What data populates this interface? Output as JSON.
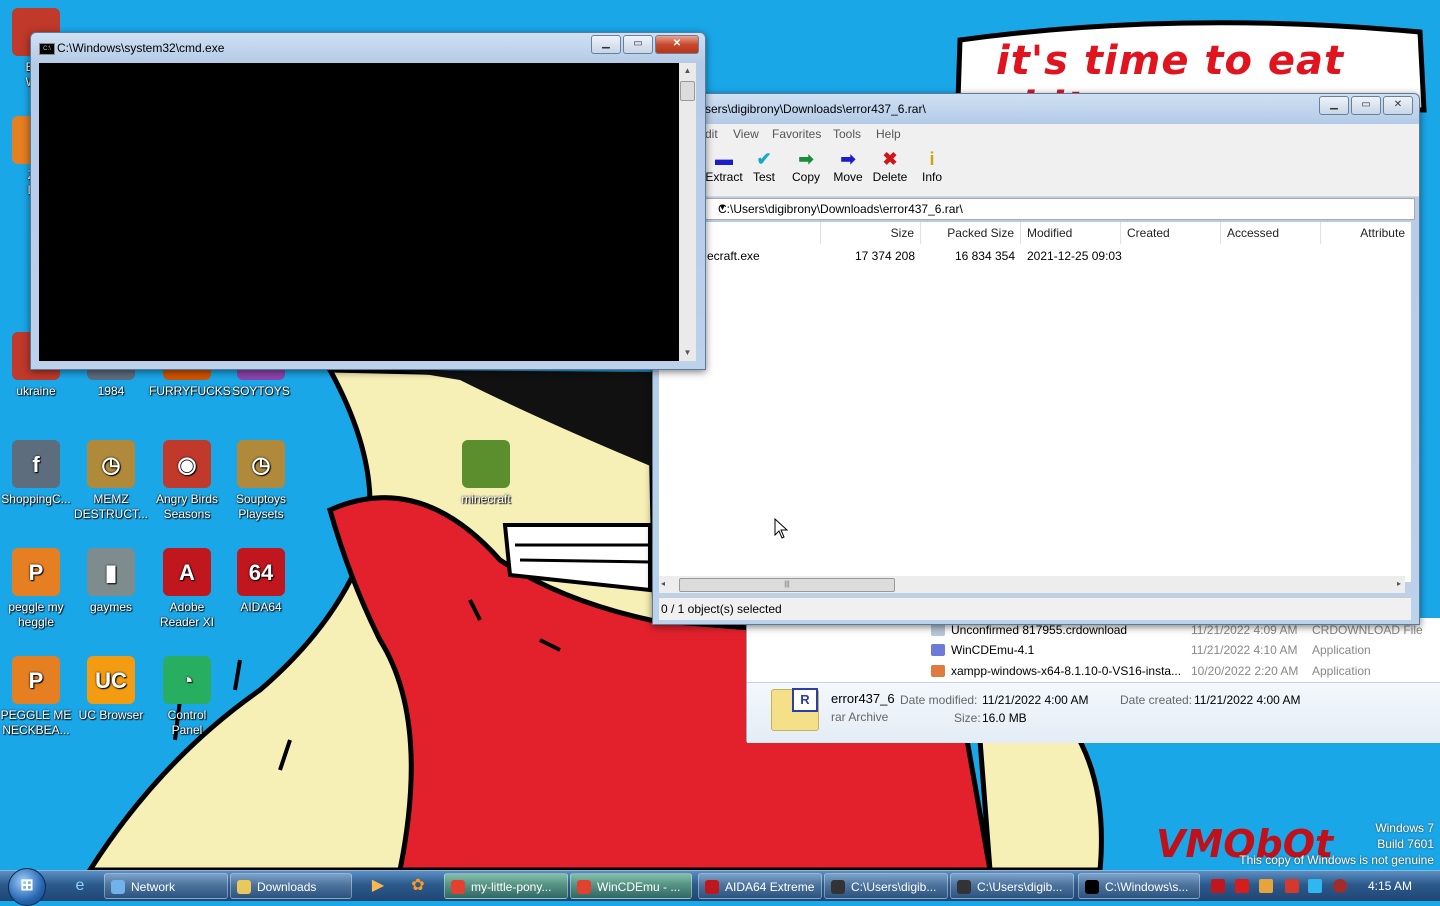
{
  "wallpaper": {
    "banner": "it's time to eat shit",
    "brand": "VMObOt",
    "watermark": [
      "Windows 7",
      "Build 7601",
      "This copy of Windows is not genuine"
    ]
  },
  "desktop_icons": [
    {
      "label": "Bos\nWin",
      "glyph": "",
      "color": "#c0392b"
    },
    {
      "label": "ZO\nDE",
      "glyph": "",
      "color": "#e67e22"
    },
    {
      "label": "ukraine",
      "glyph": "",
      "color": "#c0392b"
    },
    {
      "label": "1984",
      "glyph": "",
      "color": "#5d6d7e"
    },
    {
      "label": "FURRYFUCKS",
      "glyph": "",
      "color": "#d35400"
    },
    {
      "label": "SOYTOYS",
      "glyph": "",
      "color": "#8e44ad"
    },
    {
      "label": "ShoppingC...",
      "glyph": "f",
      "color": "#5d6d7e"
    },
    {
      "label": "MEMZ\nDESTRUCT...",
      "glyph": "◷",
      "color": "#b08a3a"
    },
    {
      "label": "Angry Birds\nSeasons",
      "glyph": "◉",
      "color": "#c0392b"
    },
    {
      "label": "Souptoys\nPlaysets",
      "glyph": "◷",
      "color": "#b08a3a"
    },
    {
      "label": "minecraft",
      "glyph": "",
      "color": "#5b8f2e"
    },
    {
      "label": "peggle my\nheggle",
      "glyph": "P",
      "color": "#e67e22"
    },
    {
      "label": "gaymes",
      "glyph": "▮",
      "color": "#7f8c8d"
    },
    {
      "label": "Adobe\nReader XI",
      "glyph": "A",
      "color": "#c0161e"
    },
    {
      "label": "AIDA64",
      "glyph": "64",
      "color": "#c0161e"
    },
    {
      "label": "PEGGLE ME\nNECKBEA...",
      "glyph": "P",
      "color": "#e67e22"
    },
    {
      "label": "UC Browser",
      "glyph": "UC",
      "color": "#f39c12"
    },
    {
      "label": "Control\nPanel",
      "glyph": "◔",
      "color": "#27ae60"
    }
  ],
  "cmd_window": {
    "title": "C:\\Windows\\system32\\cmd.exe",
    "icon": "cmd-icon"
  },
  "zip_window": {
    "title": "sers\\digibrony\\Downloads\\error437_6.rar\\",
    "menu": [
      "dit",
      "View",
      "Favorites",
      "Tools",
      "Help"
    ],
    "toolbar": [
      {
        "label": "Extract",
        "glyph": "▬",
        "color": "#1b1bd0",
        "icon": "extract-icon"
      },
      {
        "label": "Test",
        "glyph": "✔",
        "color": "#17a9c9",
        "icon": "test-icon"
      },
      {
        "label": "Copy",
        "glyph": "➡",
        "color": "#1a8c3a",
        "icon": "copy-icon"
      },
      {
        "label": "Move",
        "glyph": "➡",
        "color": "#1b1bd0",
        "icon": "move-icon"
      },
      {
        "label": "Delete",
        "glyph": "✖",
        "color": "#d01818",
        "icon": "delete-icon"
      },
      {
        "label": "Info",
        "glyph": "i",
        "color": "#c9a60b",
        "icon": "info-icon"
      }
    ],
    "address": "C:\\Users\\digibrony\\Downloads\\error437_6.rar\\",
    "columns": [
      "Size",
      "Packed Size",
      "Modified",
      "Created",
      "Accessed",
      "Attribute"
    ],
    "rows": [
      {
        "name": "ecraft.exe",
        "size": "17 374 208",
        "packed": "16 834 354",
        "modified": "2021-12-25 09:03"
      }
    ],
    "status": "0 / 1 object(s) selected"
  },
  "explorer": {
    "rows": [
      {
        "name": "Unconfirmed 817955.crdownload",
        "date": "11/21/2022 4:09 AM",
        "type": "CRDOWNLOAD File"
      },
      {
        "name": "WinCDEmu-4.1",
        "date": "11/21/2022 4:10 AM",
        "type": "Application"
      },
      {
        "name": "xampp-windows-x64-8.1.10-0-VS16-insta...",
        "date": "10/20/2022 2:20 AM",
        "type": "Application"
      }
    ],
    "details": {
      "name": "error437_6",
      "type": "rar Archive",
      "modified_label": "Date modified:",
      "modified": "11/21/2022 4:00 AM",
      "size_label": "Size:",
      "size": "16.0 MB",
      "created_label": "Date created:",
      "created": "11/21/2022 4:00 AM"
    }
  },
  "taskbar": {
    "items": [
      {
        "label": "Network",
        "icon": "network-icon"
      },
      {
        "label": "Downloads",
        "icon": "folder-icon"
      },
      {
        "label": "my-little-pony...",
        "icon": "chrome-icon",
        "active": true
      },
      {
        "label": "WinCDEmu - ...",
        "icon": "chrome-icon",
        "active": true
      },
      {
        "label": "AIDA64 Extreme",
        "icon": "aida64-icon"
      },
      {
        "label": "C:\\Users\\digib...",
        "icon": "7zip-icon"
      },
      {
        "label": "C:\\Users\\digib...",
        "icon": "7zip-icon"
      },
      {
        "label": "C:\\Windows\\s...",
        "icon": "cmd-icon"
      }
    ],
    "clock": "4:15 AM"
  }
}
